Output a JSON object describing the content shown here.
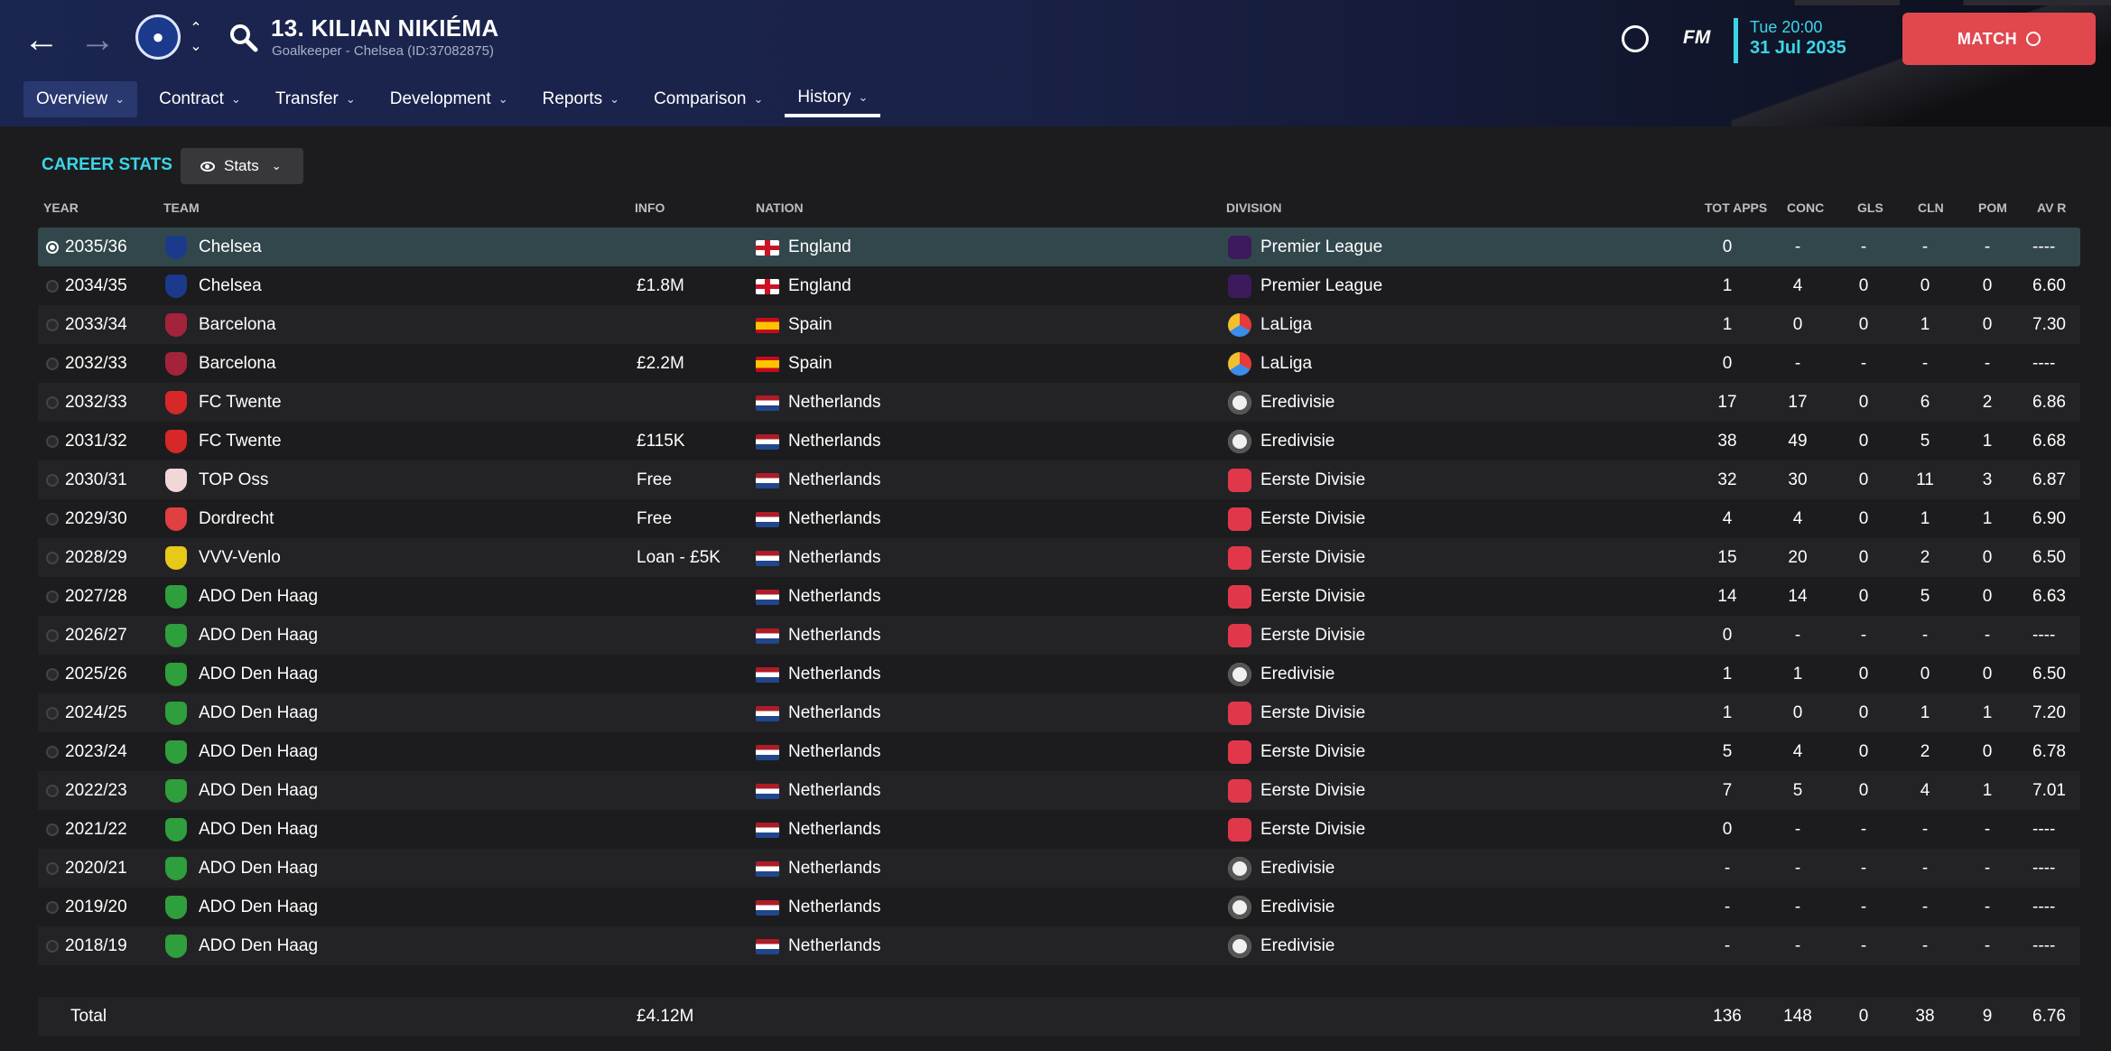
{
  "header": {
    "player_name": "13. KILIAN NIKIÉMA",
    "player_sub": "Goalkeeper - Chelsea (ID:37082875)",
    "fm_logo": "FM",
    "time": "Tue 20:00",
    "date": "31 Jul 2035",
    "match_label": "MATCH",
    "tabs": [
      {
        "label": "Overview"
      },
      {
        "label": "Contract"
      },
      {
        "label": "Transfer"
      },
      {
        "label": "Development"
      },
      {
        "label": "Reports"
      },
      {
        "label": "Comparison"
      },
      {
        "label": "History"
      }
    ]
  },
  "career": {
    "title": "CAREER STATS",
    "view_label": "Stats",
    "columns": {
      "year": "YEAR",
      "team": "TEAM",
      "info": "INFO",
      "nation": "NATION",
      "division": "DIVISION",
      "apps": "TOT APPS",
      "conc": "CONC",
      "gls": "GLS",
      "cln": "CLN",
      "pom": "POM",
      "avr": "AV R"
    },
    "rows": [
      {
        "year": "2035/36",
        "team": "Chelsea",
        "info": "",
        "nation": "England",
        "division": "Premier League",
        "apps": "0",
        "conc": "-",
        "gls": "-",
        "cln": "-",
        "pom": "-",
        "avr": "----",
        "crest": "#1b3a8c",
        "flag": "england",
        "div": "pl"
      },
      {
        "year": "2034/35",
        "team": "Chelsea",
        "info": "£1.8M",
        "nation": "England",
        "division": "Premier League",
        "apps": "1",
        "conc": "4",
        "gls": "0",
        "cln": "0",
        "pom": "0",
        "avr": "6.60",
        "crest": "#1b3a8c",
        "flag": "england",
        "div": "pl"
      },
      {
        "year": "2033/34",
        "team": "Barcelona",
        "info": "",
        "nation": "Spain",
        "division": "LaLiga",
        "apps": "1",
        "conc": "0",
        "gls": "0",
        "cln": "1",
        "pom": "0",
        "avr": "7.30",
        "crest": "#a3243a",
        "flag": "spain",
        "div": "laliga"
      },
      {
        "year": "2032/33",
        "team": "Barcelona",
        "info": "£2.2M",
        "nation": "Spain",
        "division": "LaLiga",
        "apps": "0",
        "conc": "-",
        "gls": "-",
        "cln": "-",
        "pom": "-",
        "avr": "----",
        "crest": "#a3243a",
        "flag": "spain",
        "div": "laliga"
      },
      {
        "year": "2032/33",
        "team": "FC Twente",
        "info": "",
        "nation": "Netherlands",
        "division": "Eredivisie",
        "apps": "17",
        "conc": "17",
        "gls": "0",
        "cln": "6",
        "pom": "2",
        "avr": "6.86",
        "crest": "#d62828",
        "flag": "nl",
        "div": "ere"
      },
      {
        "year": "2031/32",
        "team": "FC Twente",
        "info": "£115K",
        "nation": "Netherlands",
        "division": "Eredivisie",
        "apps": "38",
        "conc": "49",
        "gls": "0",
        "cln": "5",
        "pom": "1",
        "avr": "6.68",
        "crest": "#d62828",
        "flag": "nl",
        "div": "ere"
      },
      {
        "year": "2030/31",
        "team": "TOP Oss",
        "info": "Free",
        "nation": "Netherlands",
        "division": "Eerste Divisie",
        "apps": "32",
        "conc": "30",
        "gls": "0",
        "cln": "11",
        "pom": "3",
        "avr": "6.87",
        "crest": "#f2d7d7",
        "flag": "nl",
        "div": "eerste"
      },
      {
        "year": "2029/30",
        "team": "Dordrecht",
        "info": "Free",
        "nation": "Netherlands",
        "division": "Eerste Divisie",
        "apps": "4",
        "conc": "4",
        "gls": "0",
        "cln": "1",
        "pom": "1",
        "avr": "6.90",
        "crest": "#e04040",
        "flag": "nl",
        "div": "eerste"
      },
      {
        "year": "2028/29",
        "team": "VVV-Venlo",
        "info": "Loan - £5K",
        "nation": "Netherlands",
        "division": "Eerste Divisie",
        "apps": "15",
        "conc": "20",
        "gls": "0",
        "cln": "2",
        "pom": "0",
        "avr": "6.50",
        "crest": "#e8c818",
        "flag": "nl",
        "div": "eerste"
      },
      {
        "year": "2027/28",
        "team": "ADO Den Haag",
        "info": "",
        "nation": "Netherlands",
        "division": "Eerste Divisie",
        "apps": "14",
        "conc": "14",
        "gls": "0",
        "cln": "5",
        "pom": "0",
        "avr": "6.63",
        "crest": "#2f9e3c",
        "flag": "nl",
        "div": "eerste"
      },
      {
        "year": "2026/27",
        "team": "ADO Den Haag",
        "info": "",
        "nation": "Netherlands",
        "division": "Eerste Divisie",
        "apps": "0",
        "conc": "-",
        "gls": "-",
        "cln": "-",
        "pom": "-",
        "avr": "----",
        "crest": "#2f9e3c",
        "flag": "nl",
        "div": "eerste"
      },
      {
        "year": "2025/26",
        "team": "ADO Den Haag",
        "info": "",
        "nation": "Netherlands",
        "division": "Eredivisie",
        "apps": "1",
        "conc": "1",
        "gls": "0",
        "cln": "0",
        "pom": "0",
        "avr": "6.50",
        "crest": "#2f9e3c",
        "flag": "nl",
        "div": "ere"
      },
      {
        "year": "2024/25",
        "team": "ADO Den Haag",
        "info": "",
        "nation": "Netherlands",
        "division": "Eerste Divisie",
        "apps": "1",
        "conc": "0",
        "gls": "0",
        "cln": "1",
        "pom": "1",
        "avr": "7.20",
        "crest": "#2f9e3c",
        "flag": "nl",
        "div": "eerste"
      },
      {
        "year": "2023/24",
        "team": "ADO Den Haag",
        "info": "",
        "nation": "Netherlands",
        "division": "Eerste Divisie",
        "apps": "5",
        "conc": "4",
        "gls": "0",
        "cln": "2",
        "pom": "0",
        "avr": "6.78",
        "crest": "#2f9e3c",
        "flag": "nl",
        "div": "eerste"
      },
      {
        "year": "2022/23",
        "team": "ADO Den Haag",
        "info": "",
        "nation": "Netherlands",
        "division": "Eerste Divisie",
        "apps": "7",
        "conc": "5",
        "gls": "0",
        "cln": "4",
        "pom": "1",
        "avr": "7.01",
        "crest": "#2f9e3c",
        "flag": "nl",
        "div": "eerste"
      },
      {
        "year": "2021/22",
        "team": "ADO Den Haag",
        "info": "",
        "nation": "Netherlands",
        "division": "Eerste Divisie",
        "apps": "0",
        "conc": "-",
        "gls": "-",
        "cln": "-",
        "pom": "-",
        "avr": "----",
        "crest": "#2f9e3c",
        "flag": "nl",
        "div": "eerste"
      },
      {
        "year": "2020/21",
        "team": "ADO Den Haag",
        "info": "",
        "nation": "Netherlands",
        "division": "Eredivisie",
        "apps": "-",
        "conc": "-",
        "gls": "-",
        "cln": "-",
        "pom": "-",
        "avr": "----",
        "crest": "#2f9e3c",
        "flag": "nl",
        "div": "ere"
      },
      {
        "year": "2019/20",
        "team": "ADO Den Haag",
        "info": "",
        "nation": "Netherlands",
        "division": "Eredivisie",
        "apps": "-",
        "conc": "-",
        "gls": "-",
        "cln": "-",
        "pom": "-",
        "avr": "----",
        "crest": "#2f9e3c",
        "flag": "nl",
        "div": "ere"
      },
      {
        "year": "2018/19",
        "team": "ADO Den Haag",
        "info": "",
        "nation": "Netherlands",
        "division": "Eredivisie",
        "apps": "-",
        "conc": "-",
        "gls": "-",
        "cln": "-",
        "pom": "-",
        "avr": "----",
        "crest": "#2f9e3c",
        "flag": "nl",
        "div": "ere"
      }
    ],
    "total": {
      "label": "Total",
      "info": "£4.12M",
      "apps": "136",
      "conc": "148",
      "gls": "0",
      "cln": "38",
      "pom": "9",
      "avr": "6.76"
    }
  }
}
